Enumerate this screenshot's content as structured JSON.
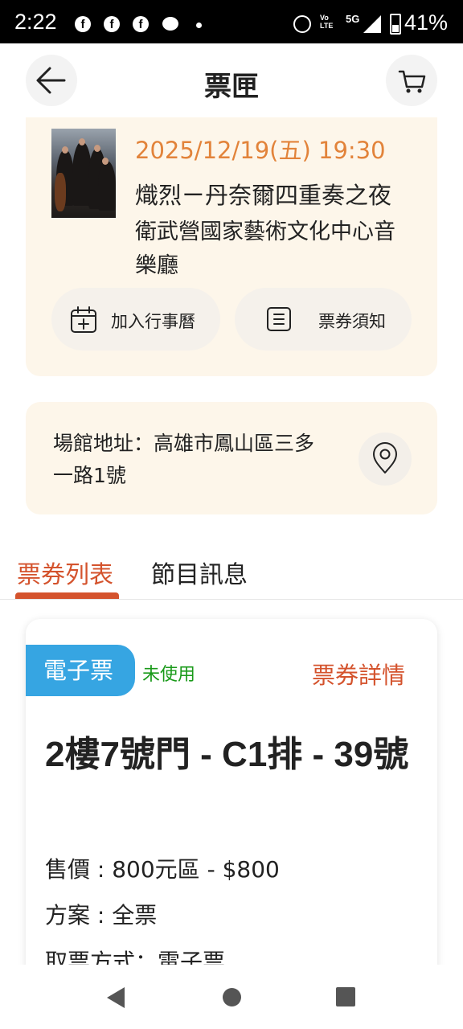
{
  "status_bar": {
    "time": "2:22",
    "notifications": [
      "facebook-icon",
      "facebook-icon",
      "facebook-icon",
      "chat-icon",
      "dot-icon"
    ],
    "network_label": "5G",
    "volte_label_top": "Vo",
    "volte_label_bottom": "LTE",
    "battery": "41%"
  },
  "header": {
    "title": "票匣",
    "back_icon": "arrow-left-icon",
    "cart_icon": "cart-icon"
  },
  "event": {
    "date_time": "2025/12/19(五) 19:30",
    "name": "熾烈ㄧ丹奈爾四重奏之夜",
    "venue": "衛武營國家藝術文化中心音樂廳",
    "add_calendar_label": "加入行事曆",
    "ticket_notice_label": "票券須知"
  },
  "address": {
    "text": "場館地址：高雄市鳳山區三多一路1號",
    "map_icon": "map-pin-icon"
  },
  "tabs": [
    {
      "label": "票券列表",
      "active": true
    },
    {
      "label": "節目訊息",
      "active": false
    }
  ],
  "ticket": {
    "type_badge": "電子票",
    "status": "未使用",
    "detail_link": "票券詳情",
    "seat": "2樓7號門 - C1排 - 39號",
    "price_line": "售價 : 800元區 - $800",
    "plan_line": "方案 : 全票",
    "pickup_line": "取票方式：電子票"
  },
  "colors": {
    "accent": "#d4532d",
    "date": "#e2833a",
    "card_bg": "#fdf6ea",
    "badge": "#36a5e2",
    "status_unused": "#1a9a1a"
  }
}
